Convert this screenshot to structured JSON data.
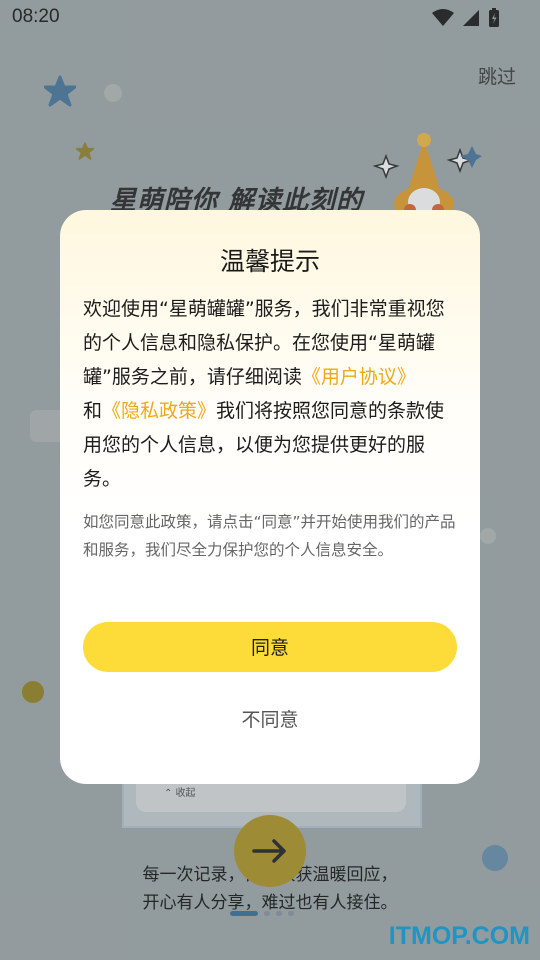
{
  "status": {
    "time": "08:20"
  },
  "background": {
    "skip_label": "跳过",
    "headline": "星萌陪你 解读此刻的",
    "collapse_label": "⌃ 收起",
    "caption_line1": "每一次记录，都会收获温暖回应，",
    "caption_line2": "开心有人分享，难过也有人接住。",
    "pager": {
      "total": 4,
      "active": 1
    }
  },
  "dialog": {
    "title": "温馨提示",
    "body_part1": "欢迎使用“星萌罐罐”服务，我们非常重视您的个人信息和隐私保护。在您使用“星萌罐罐”服务之前，请仔细阅读",
    "user_agreement_link": "《用户协议》",
    "body_and": "和",
    "privacy_policy_link": "《隐私政策》",
    "body_part2": "我们将按照您同意的条款使用您的个人信息，以便为您提供更好的服务。",
    "note": "如您同意此政策，请点击“同意”并开始使用我们的产品和服务，我们尽全力保护您的个人信息安全。",
    "agree_label": "同意",
    "disagree_label": "不同意"
  },
  "watermark": "ITMOP.COM",
  "colors": {
    "accent": "#fddc3a",
    "link": "#f0a816",
    "pager_active": "#3e79a3"
  }
}
